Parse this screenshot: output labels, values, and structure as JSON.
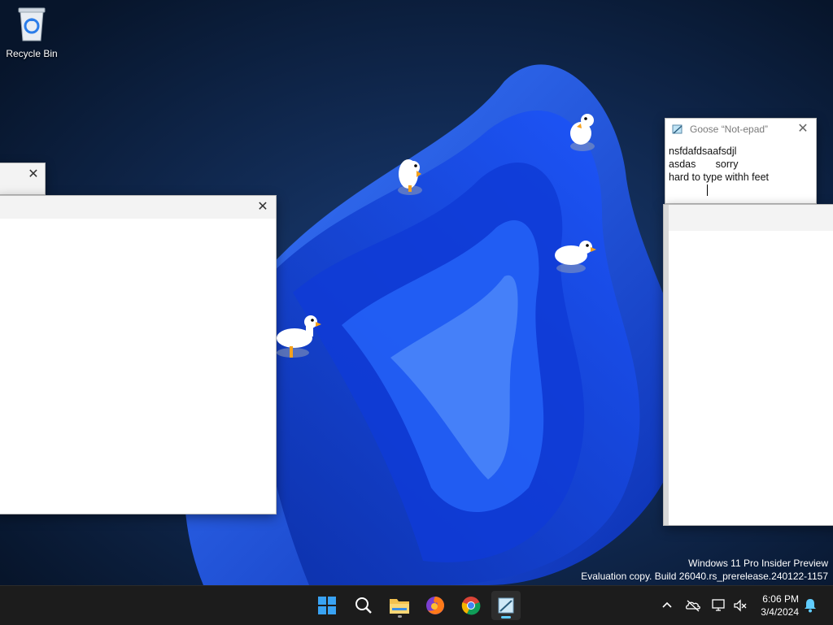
{
  "desktop": {
    "recycle_bin_label": "Recycle Bin"
  },
  "watermark": {
    "line1": "Windows 11 Pro Insider Preview",
    "line2": "Evaluation copy. Build 26040.rs_prerelease.240122-1157"
  },
  "notepad": {
    "title": "Goose “Not-epad”",
    "lines": [
      "nsfdafdsaafsdjl",
      "asdas       sorry",
      "hard to type withh feet"
    ]
  },
  "taskbar": {
    "clock_time": "6:06 PM",
    "clock_date": "3/4/2024",
    "apps": [
      "start-icon",
      "search-icon",
      "file-explorer-icon",
      "firefox-icon",
      "chrome-icon",
      "notepad-icon"
    ]
  },
  "colors": {
    "taskbar_bg": "#1c1c1c",
    "accent": "#60cdff"
  }
}
